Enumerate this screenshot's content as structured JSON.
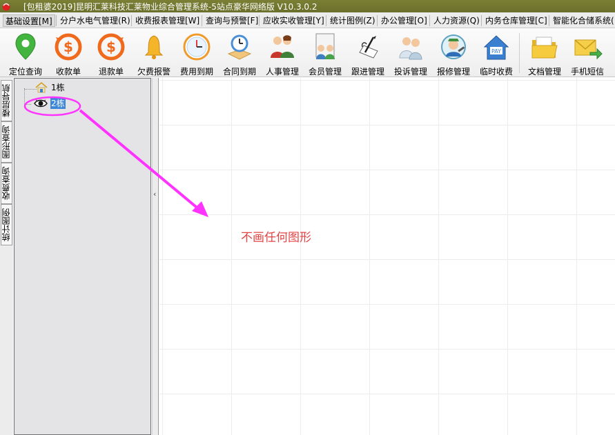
{
  "window": {
    "title": "[包租婆2019]昆明汇莱科技汇莱物业综合管理系统-5站点豪华网络版 V10.3.0.2"
  },
  "menu": [
    {
      "label": "基础设置[M]",
      "active": true
    },
    {
      "label": "分户水电气管理(R)",
      "active": false
    },
    {
      "label": "收费报表管理[W]",
      "active": false
    },
    {
      "label": "查询与预警[F]",
      "active": false
    },
    {
      "label": "应收实收管理[Y]",
      "active": false
    },
    {
      "label": "统计图例(Z)",
      "active": false
    },
    {
      "label": "办公管理[O]",
      "active": false
    },
    {
      "label": "人力资源(Q)",
      "active": false
    },
    {
      "label": "内务仓库管理[C]",
      "active": false
    },
    {
      "label": "智能化合储系统(",
      "active": false
    }
  ],
  "toolbar": [
    {
      "label": "定位查询",
      "icon": "location-pin-icon"
    },
    {
      "label": "收款单",
      "icon": "receipt-dollar-icon"
    },
    {
      "label": "退款单",
      "icon": "refund-dollar-icon"
    },
    {
      "label": "欠费报警",
      "icon": "bell-icon"
    },
    {
      "label": "费用到期",
      "icon": "clock-icon"
    },
    {
      "label": "合同到期",
      "icon": "contract-clock-icon"
    },
    {
      "label": "人事管理",
      "icon": "personnel-icon"
    },
    {
      "label": "会员管理",
      "icon": "members-icon"
    },
    {
      "label": "跟进管理",
      "icon": "followup-icon"
    },
    {
      "label": "投诉管理",
      "icon": "complaint-icon"
    },
    {
      "label": "报修管理",
      "icon": "repair-icon"
    },
    {
      "label": "临时收费",
      "icon": "temp-fee-house-icon"
    },
    {
      "label": "文档管理",
      "icon": "folder-icon"
    },
    {
      "label": "手机短信",
      "icon": "sms-envelope-icon"
    }
  ],
  "side_tabs": [
    "楼层导航",
    "图形查询",
    "收费查询",
    "统计图例"
  ],
  "tree": {
    "nodes": [
      {
        "label": "1栋",
        "icon": "building-icon",
        "selected": false
      },
      {
        "label": "2栋",
        "icon": "eye-icon",
        "selected": true
      }
    ]
  },
  "annotation": {
    "text": "不画任何图形",
    "color": "#e34444",
    "highlight_color": "#ff33ff"
  }
}
